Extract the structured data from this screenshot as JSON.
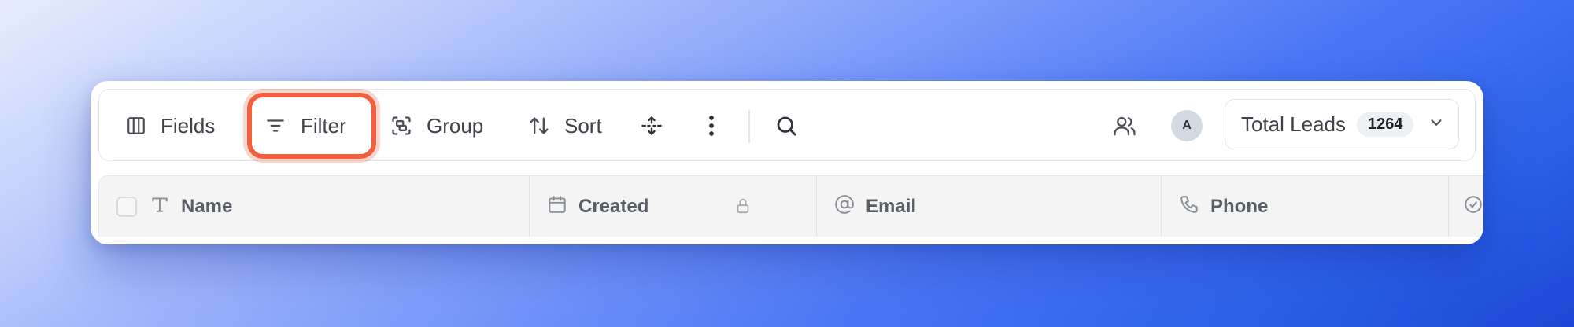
{
  "toolbar": {
    "fields_label": "Fields",
    "filter_label": "Filter",
    "group_label": "Group",
    "sort_label": "Sort",
    "avatar_initial": "A",
    "total_leads_label": "Total Leads",
    "total_leads_count": "1264"
  },
  "table": {
    "columns": [
      {
        "label": "Name",
        "icon": "text-type-icon"
      },
      {
        "label": "Created",
        "icon": "calendar-icon",
        "locked": true
      },
      {
        "label": "Email",
        "icon": "at-sign-icon"
      },
      {
        "label": "Phone",
        "icon": "phone-icon"
      }
    ]
  },
  "colors": {
    "highlight": "#f4603f",
    "accent_background": "#2b5fe8"
  }
}
